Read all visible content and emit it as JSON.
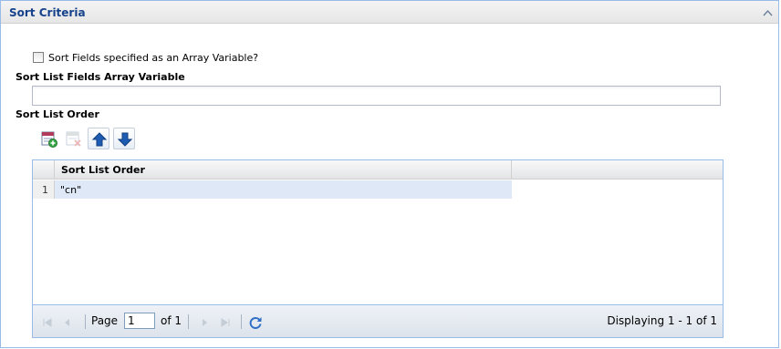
{
  "panel": {
    "title": "Sort Criteria"
  },
  "form": {
    "checkbox_label": "Sort Fields specified as an Array Variable?",
    "checkbox_checked": false,
    "array_label": "Sort List Fields Array Variable",
    "array_value": "",
    "order_label": "Sort List Order"
  },
  "toolbar": {
    "buttons": [
      {
        "icon": "add-row-icon",
        "enabled": true
      },
      {
        "icon": "remove-row-icon",
        "enabled": false
      },
      {
        "icon": "arrow-up-icon",
        "enabled": true
      },
      {
        "icon": "arrow-down-icon",
        "enabled": true
      }
    ]
  },
  "grid": {
    "column_header": "Sort List Order",
    "rows": [
      {
        "num": "1",
        "value": "\"cn\""
      }
    ]
  },
  "pager": {
    "page_label": "Page",
    "page_value": "1",
    "of_label": "of 1",
    "display_text": "Displaying 1 - 1 of 1"
  },
  "colors": {
    "title": "#15428b",
    "border": "#99bbe8",
    "selected_row": "#dfe8f6",
    "arrow_blue": "#1e5cb3"
  }
}
